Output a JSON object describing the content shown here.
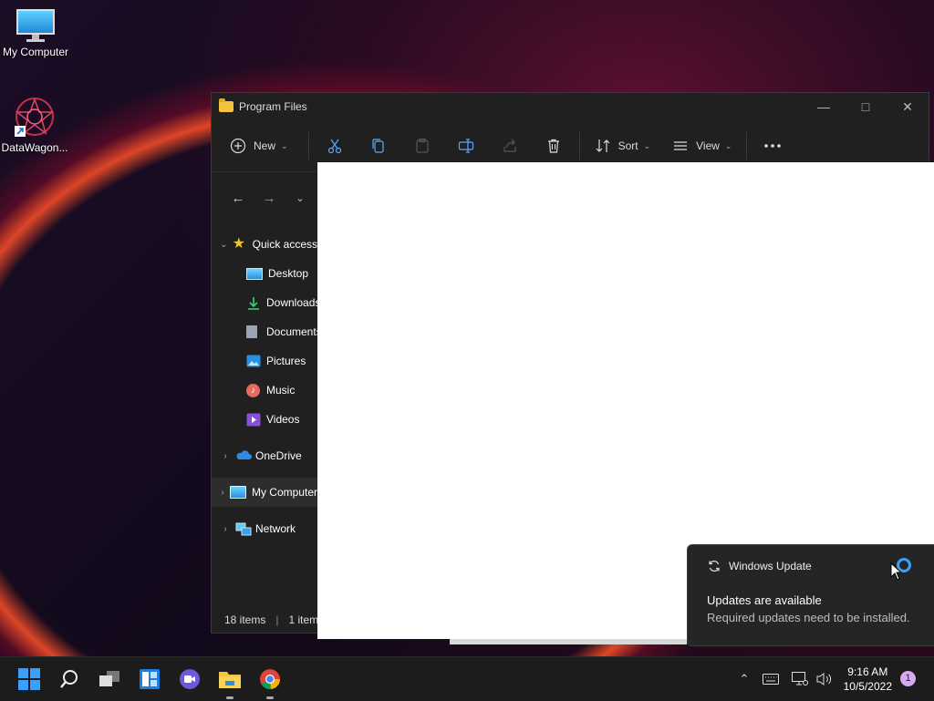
{
  "desktop": {
    "icons": [
      {
        "label": "My Computer",
        "icon": "monitor-icon"
      },
      {
        "label": "DataWagon...",
        "icon": "app-shortcut-icon"
      }
    ]
  },
  "explorer": {
    "title": "Program Files",
    "toolbar": {
      "new_label": "New",
      "sort_label": "Sort",
      "view_label": "View"
    },
    "sidebar": {
      "quick_access": "Quick access",
      "items": [
        "Desktop",
        "Downloads",
        "Documents",
        "Pictures",
        "Music",
        "Videos"
      ],
      "onedrive": "OneDrive",
      "my_computer": "My Computer",
      "network": "Network"
    },
    "status": {
      "items": "18 items",
      "selected": "1 item"
    }
  },
  "notification": {
    "app": "Windows Update",
    "title": "Updates are available",
    "message": "Required updates need to be installed."
  },
  "taskbar": {
    "time": "9:16 AM",
    "date": "10/5/2022",
    "notification_count": "1"
  },
  "colors": {
    "accent": "#3aa0ff",
    "window_bg": "#202020",
    "taskbar_bg": "#1c1c1c",
    "folder_yellow": "#f3c43c"
  }
}
